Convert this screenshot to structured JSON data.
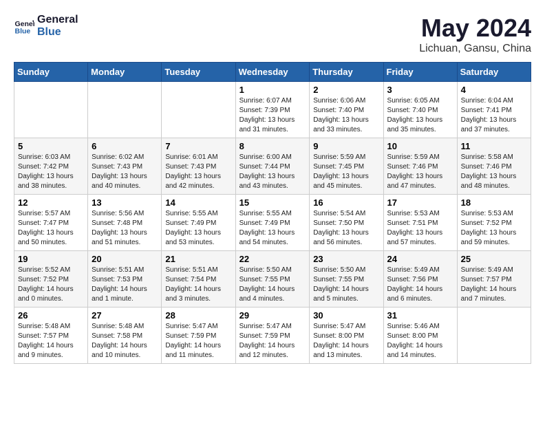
{
  "logo": {
    "line1": "General",
    "line2": "Blue"
  },
  "title": "May 2024",
  "location": "Lichuan, Gansu, China",
  "days_header": [
    "Sunday",
    "Monday",
    "Tuesday",
    "Wednesday",
    "Thursday",
    "Friday",
    "Saturday"
  ],
  "weeks": [
    [
      {
        "day": "",
        "info": ""
      },
      {
        "day": "",
        "info": ""
      },
      {
        "day": "",
        "info": ""
      },
      {
        "day": "1",
        "info": "Sunrise: 6:07 AM\nSunset: 7:39 PM\nDaylight: 13 hours\nand 31 minutes."
      },
      {
        "day": "2",
        "info": "Sunrise: 6:06 AM\nSunset: 7:40 PM\nDaylight: 13 hours\nand 33 minutes."
      },
      {
        "day": "3",
        "info": "Sunrise: 6:05 AM\nSunset: 7:40 PM\nDaylight: 13 hours\nand 35 minutes."
      },
      {
        "day": "4",
        "info": "Sunrise: 6:04 AM\nSunset: 7:41 PM\nDaylight: 13 hours\nand 37 minutes."
      }
    ],
    [
      {
        "day": "5",
        "info": "Sunrise: 6:03 AM\nSunset: 7:42 PM\nDaylight: 13 hours\nand 38 minutes."
      },
      {
        "day": "6",
        "info": "Sunrise: 6:02 AM\nSunset: 7:43 PM\nDaylight: 13 hours\nand 40 minutes."
      },
      {
        "day": "7",
        "info": "Sunrise: 6:01 AM\nSunset: 7:43 PM\nDaylight: 13 hours\nand 42 minutes."
      },
      {
        "day": "8",
        "info": "Sunrise: 6:00 AM\nSunset: 7:44 PM\nDaylight: 13 hours\nand 43 minutes."
      },
      {
        "day": "9",
        "info": "Sunrise: 5:59 AM\nSunset: 7:45 PM\nDaylight: 13 hours\nand 45 minutes."
      },
      {
        "day": "10",
        "info": "Sunrise: 5:59 AM\nSunset: 7:46 PM\nDaylight: 13 hours\nand 47 minutes."
      },
      {
        "day": "11",
        "info": "Sunrise: 5:58 AM\nSunset: 7:46 PM\nDaylight: 13 hours\nand 48 minutes."
      }
    ],
    [
      {
        "day": "12",
        "info": "Sunrise: 5:57 AM\nSunset: 7:47 PM\nDaylight: 13 hours\nand 50 minutes."
      },
      {
        "day": "13",
        "info": "Sunrise: 5:56 AM\nSunset: 7:48 PM\nDaylight: 13 hours\nand 51 minutes."
      },
      {
        "day": "14",
        "info": "Sunrise: 5:55 AM\nSunset: 7:49 PM\nDaylight: 13 hours\nand 53 minutes."
      },
      {
        "day": "15",
        "info": "Sunrise: 5:55 AM\nSunset: 7:49 PM\nDaylight: 13 hours\nand 54 minutes."
      },
      {
        "day": "16",
        "info": "Sunrise: 5:54 AM\nSunset: 7:50 PM\nDaylight: 13 hours\nand 56 minutes."
      },
      {
        "day": "17",
        "info": "Sunrise: 5:53 AM\nSunset: 7:51 PM\nDaylight: 13 hours\nand 57 minutes."
      },
      {
        "day": "18",
        "info": "Sunrise: 5:53 AM\nSunset: 7:52 PM\nDaylight: 13 hours\nand 59 minutes."
      }
    ],
    [
      {
        "day": "19",
        "info": "Sunrise: 5:52 AM\nSunset: 7:52 PM\nDaylight: 14 hours\nand 0 minutes."
      },
      {
        "day": "20",
        "info": "Sunrise: 5:51 AM\nSunset: 7:53 PM\nDaylight: 14 hours\nand 1 minute."
      },
      {
        "day": "21",
        "info": "Sunrise: 5:51 AM\nSunset: 7:54 PM\nDaylight: 14 hours\nand 3 minutes."
      },
      {
        "day": "22",
        "info": "Sunrise: 5:50 AM\nSunset: 7:55 PM\nDaylight: 14 hours\nand 4 minutes."
      },
      {
        "day": "23",
        "info": "Sunrise: 5:50 AM\nSunset: 7:55 PM\nDaylight: 14 hours\nand 5 minutes."
      },
      {
        "day": "24",
        "info": "Sunrise: 5:49 AM\nSunset: 7:56 PM\nDaylight: 14 hours\nand 6 minutes."
      },
      {
        "day": "25",
        "info": "Sunrise: 5:49 AM\nSunset: 7:57 PM\nDaylight: 14 hours\nand 7 minutes."
      }
    ],
    [
      {
        "day": "26",
        "info": "Sunrise: 5:48 AM\nSunset: 7:57 PM\nDaylight: 14 hours\nand 9 minutes."
      },
      {
        "day": "27",
        "info": "Sunrise: 5:48 AM\nSunset: 7:58 PM\nDaylight: 14 hours\nand 10 minutes."
      },
      {
        "day": "28",
        "info": "Sunrise: 5:47 AM\nSunset: 7:59 PM\nDaylight: 14 hours\nand 11 minutes."
      },
      {
        "day": "29",
        "info": "Sunrise: 5:47 AM\nSunset: 7:59 PM\nDaylight: 14 hours\nand 12 minutes."
      },
      {
        "day": "30",
        "info": "Sunrise: 5:47 AM\nSunset: 8:00 PM\nDaylight: 14 hours\nand 13 minutes."
      },
      {
        "day": "31",
        "info": "Sunrise: 5:46 AM\nSunset: 8:00 PM\nDaylight: 14 hours\nand 14 minutes."
      },
      {
        "day": "",
        "info": ""
      }
    ]
  ]
}
